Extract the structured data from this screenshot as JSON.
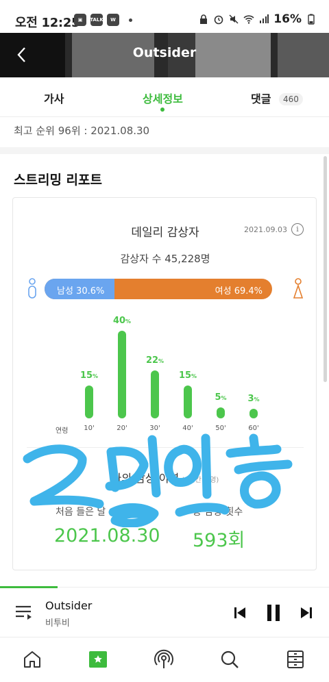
{
  "status_bar": {
    "time": "오전 12:25",
    "battery": "16%"
  },
  "header": {
    "title": "Outsider"
  },
  "tabs": [
    {
      "label": "가사"
    },
    {
      "label": "상세정보"
    },
    {
      "label": "댓글",
      "count": "460"
    }
  ],
  "rank_info": "최고 순위 96위 : 2021.08.30",
  "streaming_report": {
    "section_title": "스트리밍 리포트",
    "card_title": "데일리 감상자",
    "date": "2021.09.03",
    "listeners": "감상자 수 45,228명",
    "gender": {
      "male_label": "남성 30.6%",
      "female_label": "여성 69.4%",
      "male_fraction": 0.306
    },
    "age_axis_label": "연령",
    "ages": [
      {
        "tick": "10'",
        "value_text": "15",
        "percent": 15
      },
      {
        "tick": "20'",
        "value_text": "40",
        "percent": 40
      },
      {
        "tick": "30'",
        "value_text": "22",
        "percent": 22
      },
      {
        "tick": "40'",
        "value_text": "15",
        "percent": 15
      },
      {
        "tick": "50'",
        "value_text": "5",
        "percent": 5
      },
      {
        "tick": "60'",
        "value_text": "3",
        "percent": 3
      }
    ],
    "history": {
      "title": "나의 감상 이력",
      "subtitle": "(1시간 반영)",
      "first_label": "처음 들은 날",
      "first_value": "2021.08.30",
      "total_label": "총 감상 횟수",
      "total_value": "593회"
    }
  },
  "overlay_text": "2밍인증",
  "player": {
    "song": "Outsider",
    "artist": "비투비"
  },
  "colors": {
    "accent": "#3dbb3d",
    "male": "#6aa5ef",
    "female": "#e47f2e",
    "scribble": "#3fb4ea"
  }
}
